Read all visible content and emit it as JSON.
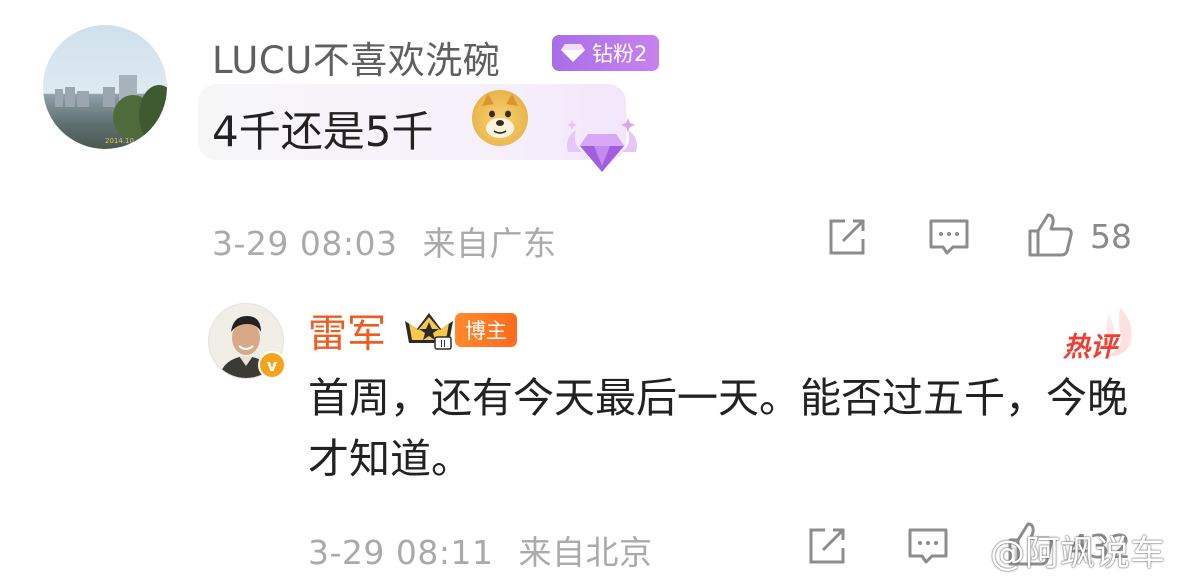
{
  "comment": {
    "user_name": "LUCU不喜欢洗碗",
    "fan_badge": "钻粉2",
    "text": "4千还是5千",
    "emoji": "doge-icon",
    "time": "3-29 08:03",
    "location": "来自广东",
    "like_count": "58"
  },
  "reply": {
    "user_name": "雷军",
    "owner_badge": "博主",
    "crown_level": "II",
    "verified_badge": "v",
    "hot_tag": "热评",
    "text": "首周，还有今天最后一天。能否过五千，今晚才知道。",
    "time": "3-29 08:11",
    "location": "来自北京",
    "like_count": "432"
  },
  "watermark": "@阿飒说车",
  "colors": {
    "reply_name": "#f05b1f",
    "fan_badge": "#b678ec",
    "hot_tag": "#ef3e34",
    "meta_text": "#aaaaaa"
  }
}
